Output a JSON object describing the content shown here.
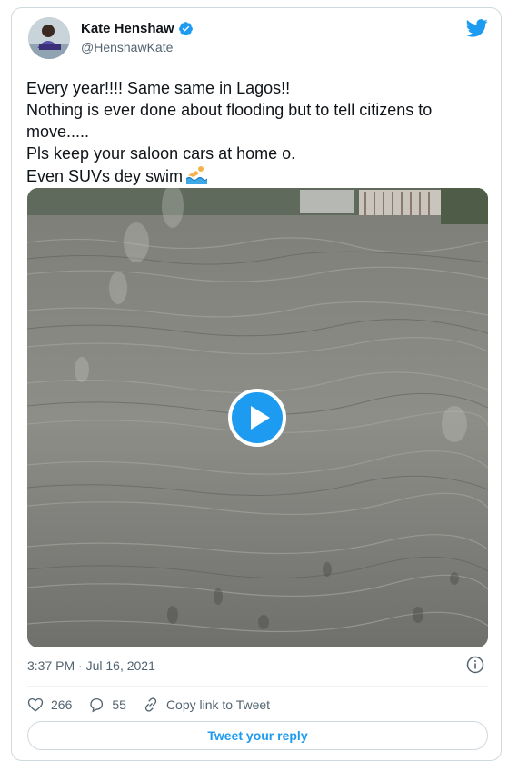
{
  "author": {
    "display_name": "Kate Henshaw",
    "handle": "@HenshawKate",
    "verified": true
  },
  "tweet": {
    "lines": [
      "Every year!!!! Same same in Lagos!!",
      "Nothing is ever done about flooding but to tell citizens to",
      "move.....",
      "Pls keep your saloon cars at home o.",
      "Even SUVs dey swim"
    ],
    "emoji_icon": "person-swimming-icon",
    "timestamp": "3:37 PM · Jul 16, 2021"
  },
  "media": {
    "type": "video",
    "play_icon": "play-icon"
  },
  "actions": {
    "likes": "266",
    "replies": "55",
    "copy_link_label": "Copy link to Tweet"
  },
  "reply_button_label": "Tweet your reply",
  "colors": {
    "accent": "#1d9bf0",
    "text": "#0f1419",
    "secondary": "#536471",
    "border": "#cfd9de"
  }
}
